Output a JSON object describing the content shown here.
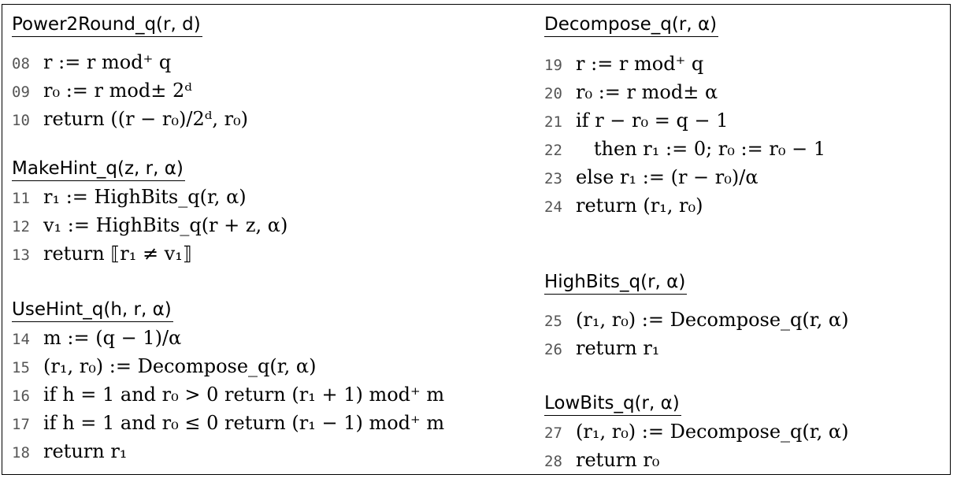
{
  "left_column": {
    "procedures": [
      {
        "title": "Power2Round_q(r, d)",
        "lines": [
          {
            "num": "08",
            "code": "r := r mod⁺ q"
          },
          {
            "num": "09",
            "code": "r₀ := r mod± 2ᵈ"
          },
          {
            "num": "10",
            "code": "return ((r − r₀)/2ᵈ, r₀)"
          }
        ]
      },
      {
        "title": "MakeHint_q(z, r, α)",
        "lines": [
          {
            "num": "11",
            "code": "r₁ := HighBits_q(r, α)"
          },
          {
            "num": "12",
            "code": "v₁ := HighBits_q(r + z, α)"
          },
          {
            "num": "13",
            "code": "return ⟦r₁ ≠ v₁⟧"
          }
        ]
      },
      {
        "title": "UseHint_q(h, r, α)",
        "lines": [
          {
            "num": "14",
            "code": "m := (q − 1)/α"
          },
          {
            "num": "15",
            "code": "(r₁, r₀) := Decompose_q(r, α)"
          },
          {
            "num": "16",
            "code": "if h = 1 and r₀ > 0 return (r₁ + 1) mod⁺ m"
          },
          {
            "num": "17",
            "code": "if h = 1 and r₀ ≤ 0 return (r₁ − 1) mod⁺ m"
          },
          {
            "num": "18",
            "code": "return r₁"
          }
        ]
      }
    ]
  },
  "right_column": {
    "procedures": [
      {
        "title": "Decompose_q(r, α)",
        "lines": [
          {
            "num": "19",
            "code": "r := r mod⁺ q"
          },
          {
            "num": "20",
            "code": "r₀ := r mod± α"
          },
          {
            "num": "21",
            "code": "if r − r₀ = q − 1"
          },
          {
            "num": "22",
            "code": "   then r₁ := 0; r₀ := r₀ − 1"
          },
          {
            "num": "23",
            "code": "else r₁ := (r − r₀)/α"
          },
          {
            "num": "24",
            "code": "return (r₁, r₀)"
          }
        ]
      },
      {
        "title": "HighBits_q(r, α)",
        "lines": [
          {
            "num": "25",
            "code": "(r₁, r₀) := Decompose_q(r, α)"
          },
          {
            "num": "26",
            "code": "return r₁"
          }
        ]
      },
      {
        "title": "LowBits_q(r, α)",
        "lines": [
          {
            "num": "27",
            "code": "(r₁, r₀) := Decompose_q(r, α)"
          },
          {
            "num": "28",
            "code": "return r₀"
          }
        ]
      }
    ]
  }
}
